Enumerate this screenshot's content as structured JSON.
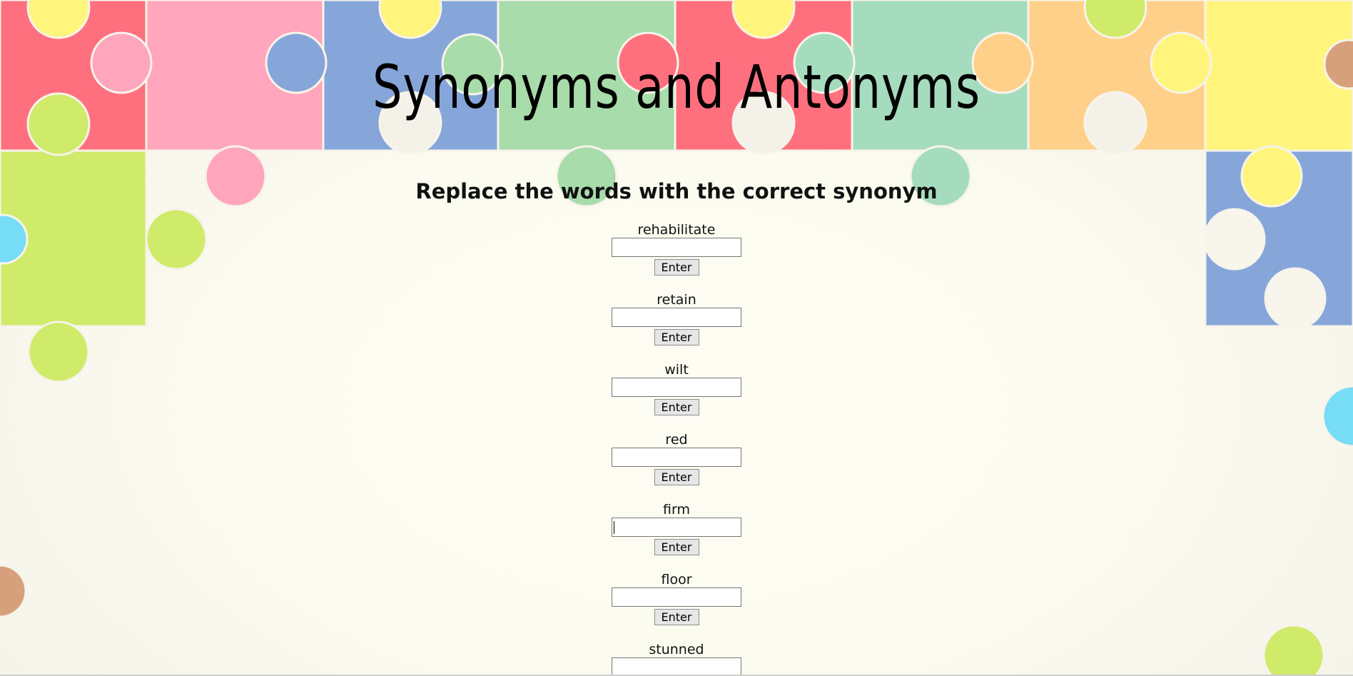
{
  "page": {
    "title": "Synonyms and Antonyms",
    "subtitle": "Replace the words with the correct synonym"
  },
  "exercise": {
    "enter_label": "Enter",
    "focused_index": 4,
    "items": [
      {
        "word": "rehabilitate",
        "value": ""
      },
      {
        "word": "retain",
        "value": ""
      },
      {
        "word": "wilt",
        "value": ""
      },
      {
        "word": "red",
        "value": ""
      },
      {
        "word": "firm",
        "value": ""
      },
      {
        "word": "floor",
        "value": ""
      },
      {
        "word": "stunned",
        "value": ""
      }
    ]
  },
  "background": {
    "pattern": "jigsaw-puzzle-pieces",
    "colors": {
      "red": "#ff707f",
      "pink": "#ffa6bd",
      "blue": "#86a6da",
      "green": "#a8dcab",
      "mint": "#a6dcbe",
      "orange": "#ffd089",
      "yellow": "#fff57c",
      "lime": "#d0ea6a",
      "cyan": "#77dcf5",
      "tan": "#d7a07c"
    }
  }
}
